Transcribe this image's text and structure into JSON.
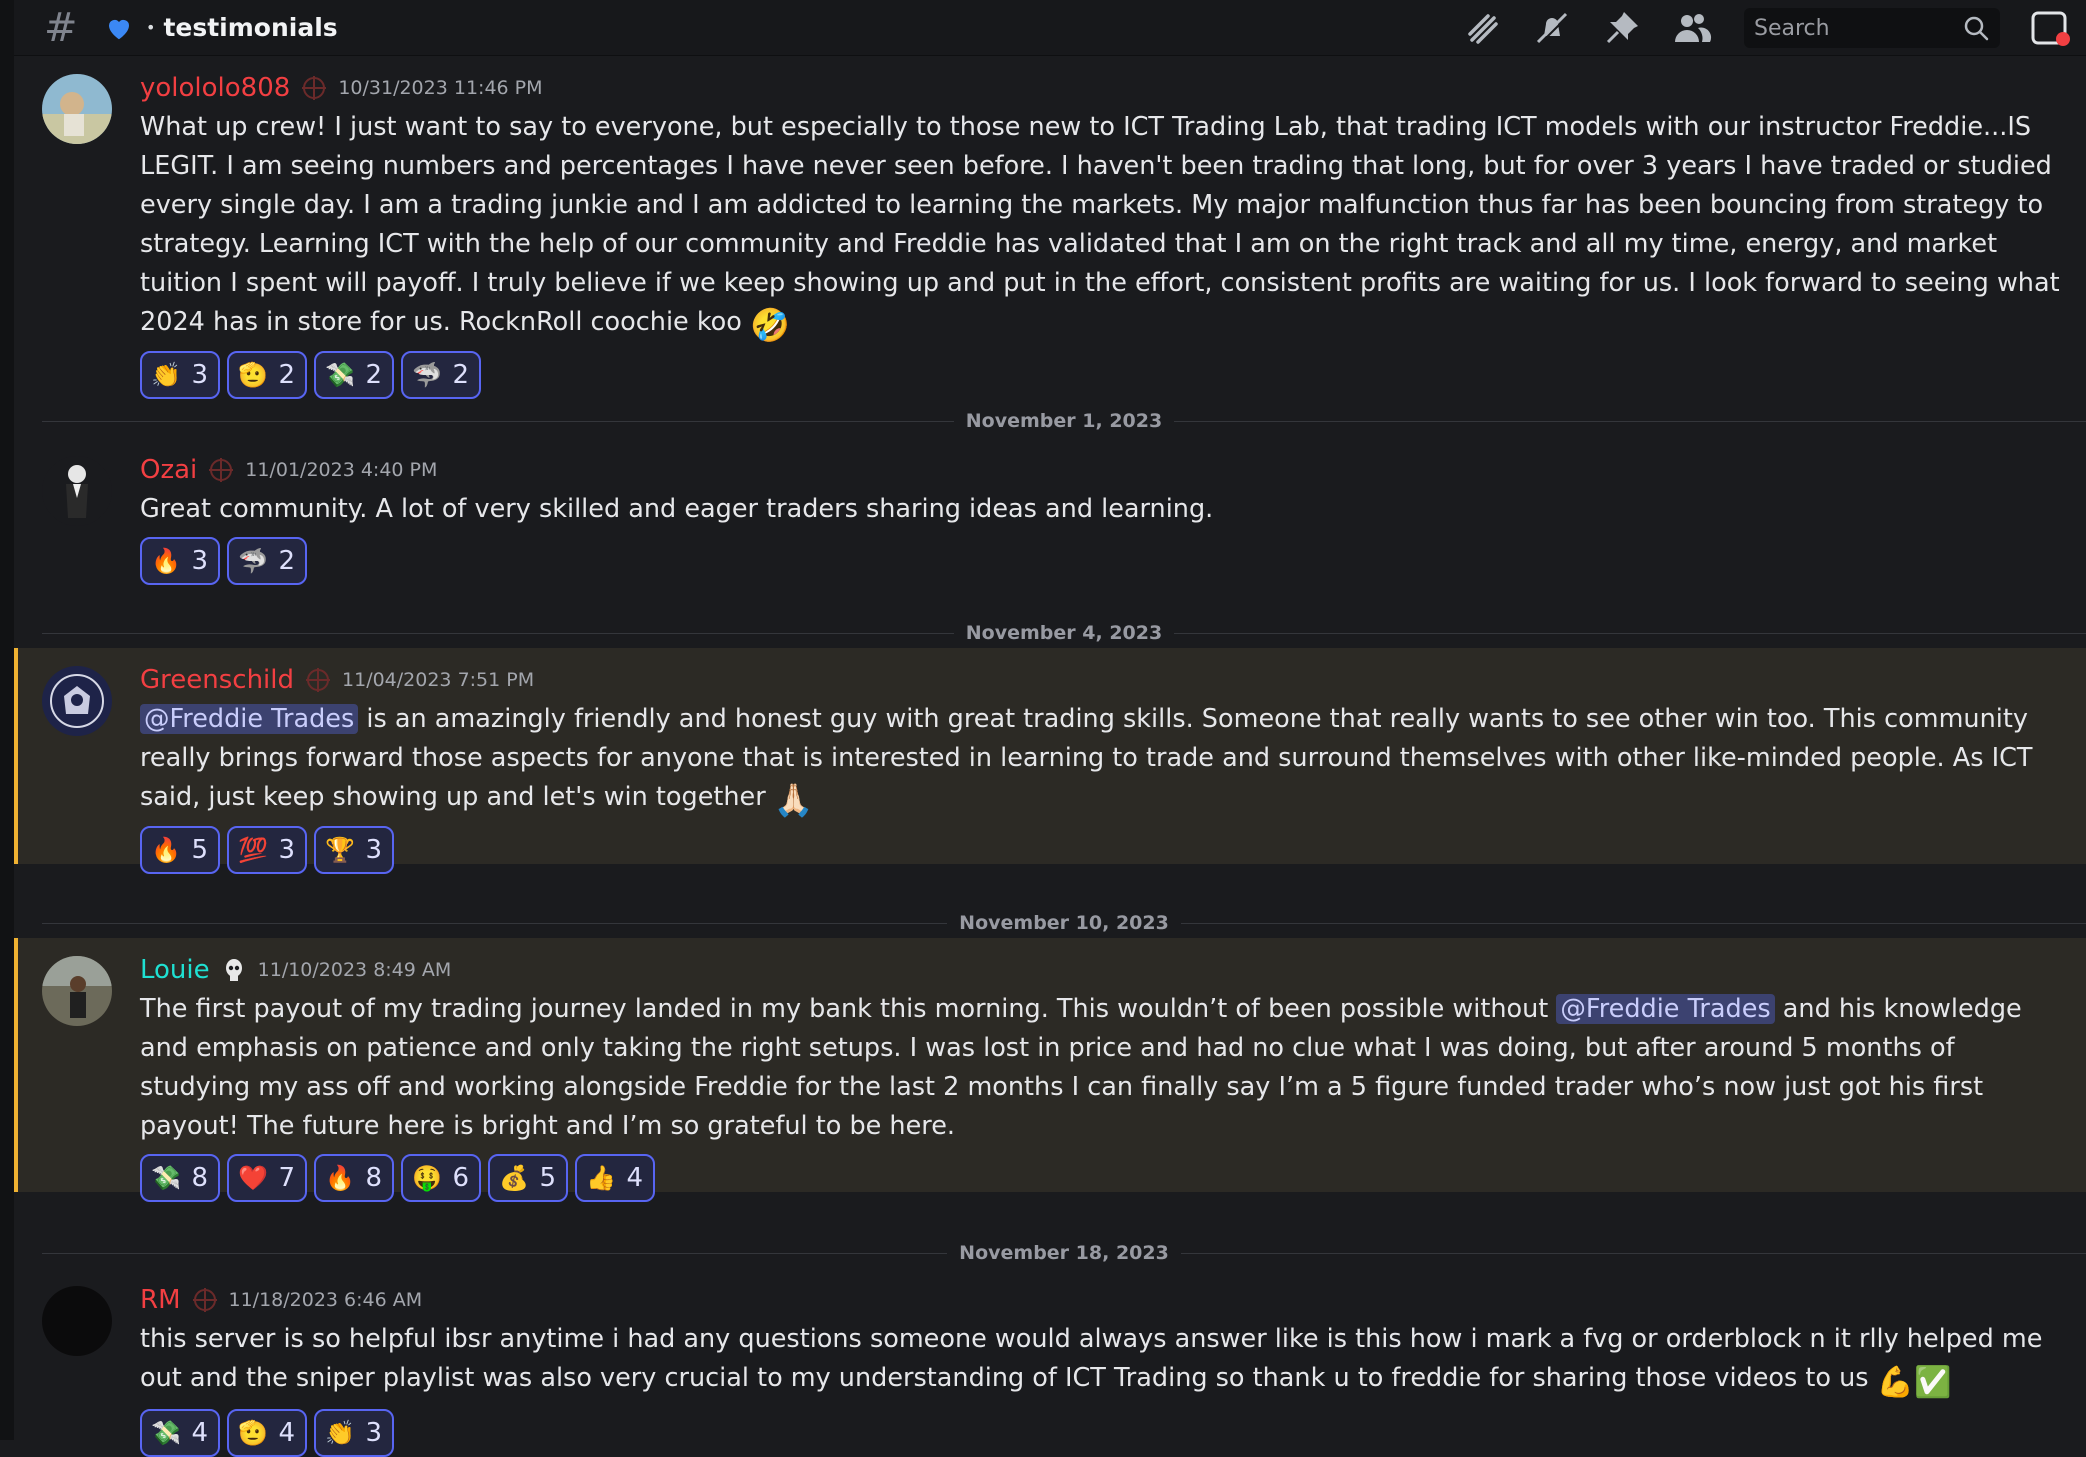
{
  "header": {
    "channel_name": "testimonials",
    "search_placeholder": "Search"
  },
  "messages": [
    {
      "username": "yolololo808",
      "username_color": "#f23f42",
      "timestamp": "10/31/2023 11:46 PM",
      "text": "What up crew! I just want to say to everyone, but especially to those new to ICT Trading Lab, that trading ICT models with our instructor Freddie...IS LEGIT.  I am seeing numbers and percentages I have never seen before. I haven't been trading that long, but for over 3 years I have traded or studied every single day. I am a trading junkie and I am addicted to learning the markets.  My major malfunction thus far has been bouncing from strategy to strategy. Learning ICT with the help of our community and Freddie has validated that I am on the right track and all my time, energy, and market tuition I spent will payoff. I truly believe if we keep showing up and put in the effort, consistent profits are waiting for us. I look forward to seeing what 2024 has in store for us. RocknRoll coochie koo",
      "trailing_emoji": "🤣",
      "reactions": [
        {
          "emoji": "👏",
          "name": "clap-emoji",
          "count": "3"
        },
        {
          "emoji": "🫡",
          "name": "salute-emoji",
          "count": "2"
        },
        {
          "emoji": "💸",
          "name": "money-wings-emoji",
          "count": "2"
        },
        {
          "emoji": "🦈",
          "name": "shark-emoji",
          "count": "2"
        }
      ]
    },
    {
      "username": "Ozai",
      "username_color": "#f23f42",
      "timestamp": "11/01/2023 4:40 PM",
      "text": "Great community. A lot of very skilled and eager traders sharing ideas and learning.",
      "reactions": [
        {
          "emoji": "🔥",
          "name": "fire-emoji",
          "count": "3"
        },
        {
          "emoji": "🦈",
          "name": "shark-emoji",
          "count": "2"
        }
      ]
    },
    {
      "username": "Greenschild",
      "username_color": "#f23f42",
      "timestamp": "11/04/2023 7:51 PM",
      "mention": "@Freddie Trades",
      "text": " is an amazingly friendly and honest guy with great trading skills. Someone that really wants to see other win too. This community really brings forward those aspects for anyone that is interested in learning to trade and surround themselves with other like-minded people. As ICT said, just keep showing up and let's win together",
      "trailing_emoji": "🙏🏻",
      "reactions": [
        {
          "emoji": "🔥",
          "name": "fire-emoji",
          "count": "5"
        },
        {
          "emoji": "💯",
          "name": "hundred-emoji",
          "count": "3"
        },
        {
          "emoji": "🏆",
          "name": "trophy-emoji",
          "count": "3"
        }
      ]
    },
    {
      "username": "Louie",
      "username_color": "#1fe0d2",
      "timestamp": "11/10/2023 8:49 AM",
      "text_before": "The first payout of my trading journey landed in my bank this morning. This wouldn’t of been possible without ",
      "mention": "@Freddie Trades",
      "text_after": " and his knowledge and emphasis on patience and only taking the right setups. I was lost in price and had no clue what I was doing, but after around 5 months of studying my ass off and working alongside Freddie for the last 2 months I can finally say I’m a 5 figure funded trader who’s now just got his first payout! The future here is bright and I’m so grateful to be here.",
      "reactions": [
        {
          "emoji": "💸",
          "name": "money-wings-emoji",
          "count": "8"
        },
        {
          "emoji": "❤️",
          "name": "heart-emoji",
          "count": "7"
        },
        {
          "emoji": "🔥",
          "name": "fire-emoji",
          "count": "8"
        },
        {
          "emoji": "🤑",
          "name": "money-mouth-emoji",
          "count": "6"
        },
        {
          "emoji": "💰",
          "name": "money-bag-emoji",
          "count": "5"
        },
        {
          "emoji": "👍",
          "name": "thumbs-up-emoji",
          "count": "4"
        }
      ]
    },
    {
      "username": "RM",
      "username_color": "#f23f42",
      "timestamp": "11/18/2023 6:46 AM",
      "text": "this server is so helpful ibsr anytime i had any questions someone would always answer like is this how i mark a fvg or orderblock n it rlly helped me out and the sniper playlist was also very crucial to my understanding of ICT Trading so thank u to freddie for sharing those videos to us",
      "trailing_emoji": "💪✅",
      "reactions": [
        {
          "emoji": "💸",
          "name": "money-wings-emoji",
          "count": "4"
        },
        {
          "emoji": "🫡",
          "name": "salute-emoji",
          "count": "4"
        },
        {
          "emoji": "👏",
          "name": "clap-emoji",
          "count": "3"
        }
      ]
    }
  ],
  "dividers": [
    "November 1, 2023",
    "November 4, 2023",
    "November 10, 2023",
    "November 18, 2023"
  ]
}
